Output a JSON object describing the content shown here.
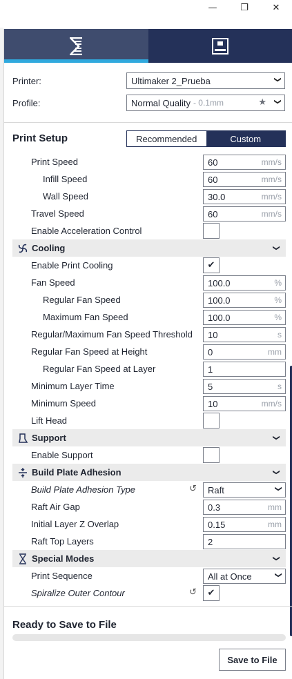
{
  "window": {
    "minimize": "—",
    "restore": "❐",
    "close": "✕"
  },
  "mode_tabs": [
    {
      "name": "print-setup-tab",
      "active": true
    },
    {
      "name": "monitor-tab",
      "active": false
    }
  ],
  "printer": {
    "label": "Printer:",
    "value": "Ultimaker 2_Prueba"
  },
  "profile": {
    "label": "Profile:",
    "value": "Normal Quality",
    "suffix": "- 0.1mm"
  },
  "print_setup": {
    "title": "Print Setup",
    "recommended": "Recommended",
    "custom": "Custom"
  },
  "speed": {
    "print_speed": {
      "label": "Print Speed",
      "value": "60",
      "unit": "mm/s"
    },
    "infill_speed": {
      "label": "Infill Speed",
      "value": "60",
      "unit": "mm/s"
    },
    "wall_speed": {
      "label": "Wall Speed",
      "value": "30.0",
      "unit": "mm/s"
    },
    "travel_speed": {
      "label": "Travel Speed",
      "value": "60",
      "unit": "mm/s"
    },
    "accel_control": {
      "label": "Enable Acceleration Control",
      "checked": false
    }
  },
  "cooling": {
    "title": "Cooling",
    "enable_cooling": {
      "label": "Enable Print Cooling",
      "mark": "✔"
    },
    "fan_speed": {
      "label": "Fan Speed",
      "value": "100.0",
      "unit": "%"
    },
    "regular_fan": {
      "label": "Regular Fan Speed",
      "value": "100.0",
      "unit": "%"
    },
    "max_fan": {
      "label": "Maximum Fan Speed",
      "value": "100.0",
      "unit": "%"
    },
    "threshold": {
      "label": "Regular/Maximum Fan Speed Threshold",
      "value": "10",
      "unit": "s"
    },
    "fan_height": {
      "label": "Regular Fan Speed at Height",
      "value": "0",
      "unit": "mm"
    },
    "fan_layer": {
      "label": "Regular Fan Speed at Layer",
      "value": "1",
      "unit": ""
    },
    "min_layer_time": {
      "label": "Minimum Layer Time",
      "value": "5",
      "unit": "s"
    },
    "min_speed": {
      "label": "Minimum Speed",
      "value": "10",
      "unit": "mm/s"
    },
    "lift_head": {
      "label": "Lift Head",
      "checked": false
    }
  },
  "support": {
    "title": "Support",
    "enable_support": {
      "label": "Enable Support",
      "checked": false
    }
  },
  "adhesion": {
    "title": "Build Plate Adhesion",
    "type": {
      "label": "Build Plate Adhesion Type",
      "value": "Raft"
    },
    "raft_air_gap": {
      "label": "Raft Air Gap",
      "value": "0.3",
      "unit": "mm"
    },
    "z_overlap": {
      "label": "Initial Layer Z Overlap",
      "value": "0.15",
      "unit": "mm"
    },
    "raft_top_layers": {
      "label": "Raft Top Layers",
      "value": "2",
      "unit": ""
    }
  },
  "special": {
    "title": "Special Modes",
    "print_sequence": {
      "label": "Print Sequence",
      "value": "All at Once"
    },
    "spiralize": {
      "label": "Spiralize Outer Contour",
      "mark": "✔"
    }
  },
  "footer": {
    "status": "Ready to Save to File",
    "progress": 0,
    "save_button": "Save to File"
  },
  "colors": {
    "nav": "#243159",
    "nav_active": "#3f4c6e",
    "accent": "#30a9de",
    "category_bg": "#ebebeb"
  },
  "glyphs": {
    "chevron": "❯",
    "reset": "↺",
    "star": "★"
  }
}
